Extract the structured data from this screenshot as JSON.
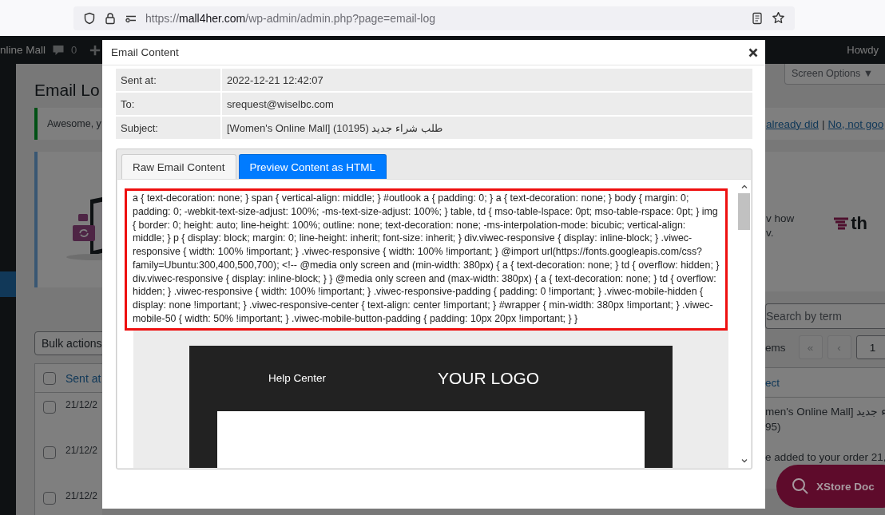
{
  "browser": {
    "url_scheme": "https://",
    "url_host": "mall4her.com",
    "url_path": "/wp-admin/admin.php?page=email-log"
  },
  "admin_bar": {
    "site_name": "nline Mall",
    "comments_count": "0",
    "greeting": "Howdy"
  },
  "background_left": {
    "heading": "Email Lo",
    "notice": "Awesome, y",
    "bulk_actions": "Bulk actions",
    "column_header": "Sent at",
    "select_all_checked": false,
    "rows": [
      {
        "date": "21/12/2",
        "checked": false
      },
      {
        "date": "21/12/2",
        "checked": false
      },
      {
        "date": "21/12/2",
        "checked": false
      }
    ]
  },
  "background_right": {
    "screen_options": "Screen Options ▼",
    "notice_links": [
      "already did",
      "No, not goo"
    ],
    "notice_separator": "|",
    "banner_lines": [
      "v how",
      "v."
    ],
    "logo_text": "th",
    "search_placeholder": "Search by term",
    "items_label": "ems",
    "pagination": [
      "«",
      "‹",
      "1"
    ],
    "column_header": "ect",
    "rows": [
      {
        "lines": [
          "men's Online Mall] ء جديد",
          "95)"
        ]
      },
      {
        "lines": [
          "e added to your order 21,"
        ]
      }
    ],
    "help_button": "XStore Doc"
  },
  "modal": {
    "title": "Email Content",
    "fields": [
      {
        "label": "Sent at:",
        "value": "2022-12-21 12:42:07"
      },
      {
        "label": "To:",
        "value": "srequest@wiselbc.com"
      },
      {
        "label": "Subject:",
        "value": "[Women's Online Mall] (10195) طلب شراء جديد"
      }
    ],
    "tabs": [
      {
        "label": "Raw Email Content",
        "selected": false
      },
      {
        "label": "Preview Content as HTML",
        "selected": true
      }
    ],
    "code": "a { text-decoration: none; } span { vertical-align: middle; } #outlook a { padding: 0; } a { text-decoration: none; } body { margin: 0; padding: 0; -webkit-text-size-adjust: 100%; -ms-text-size-adjust: 100%; } table, td { mso-table-lspace: 0pt; mso-table-rspace: 0pt; } img { border: 0; height: auto; line-height: 100%; outline: none; text-decoration: none; -ms-interpolation-mode: bicubic; vertical-align: middle; } p { display: block; margin: 0; line-height: inherit; font-size: inherit; } div.viwec-responsive { display: inline-block; } .viwec-responsive { width: 100% !important; } .viwec-responsive { width: 100% !important; } @import url(https://fonts.googleapis.com/css?family=Ubuntu:300,400,500,700); <!-- @media only screen and (min-width: 380px) { a { text-decoration: none; } td { overflow: hidden; } div.viwec-responsive { display: inline-block; } } @media only screen and (max-width: 380px) { a { text-decoration: none; } td { overflow: hidden; } .viwec-responsive { width: 100% !important; } .viwec-responsive-padding { padding: 0 !important; } .viwec-mobile-hidden { display: none !important; } .viwec-responsive-center { text-align: center !important; } #wrapper { min-width: 380px !important; } .viwec-mobile-50 { width: 50% !important; } .viwec-mobile-button-padding { padding: 10px 20px !important; } }",
    "email_preview": {
      "header_link": "Help Center",
      "logo_text": "YOUR LOGO"
    }
  }
}
